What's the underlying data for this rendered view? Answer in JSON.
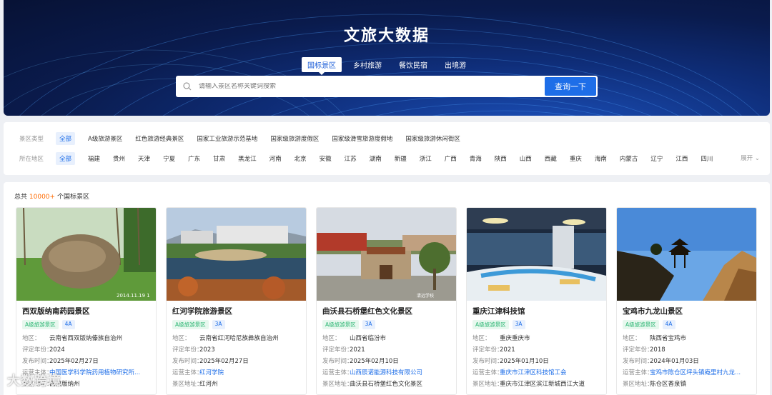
{
  "banner": {
    "title": "文旅大数据",
    "tabs": [
      {
        "label": "国标景区",
        "active": true
      },
      {
        "label": "乡村旅游"
      },
      {
        "label": "餐饮民宿"
      },
      {
        "label": "出境游"
      }
    ],
    "search_placeholder": "请输入景区名称关键词搜索",
    "search_button": "查询一下"
  },
  "filters": {
    "type_label": "景区类型",
    "type_options": [
      "全部",
      "A级旅游景区",
      "红色旅游经典景区",
      "国家工业旅游示范基地",
      "国家级旅游度假区",
      "国家级滑雪旅游度假地",
      "国家级旅游休闲街区"
    ],
    "region_label": "所在地区",
    "region_options": [
      "全部",
      "福建",
      "贵州",
      "天津",
      "宁夏",
      "广东",
      "甘肃",
      "黑龙江",
      "河南",
      "北京",
      "安徽",
      "江苏",
      "湖南",
      "新疆",
      "浙江",
      "广西",
      "青海",
      "陕西",
      "山西",
      "西藏",
      "重庆",
      "海南",
      "内蒙古",
      "辽宁",
      "江西",
      "四川"
    ],
    "expand": "展开"
  },
  "results": {
    "total_prefix": "总共",
    "total_count": "10000+",
    "total_suffix": "个国标景区"
  },
  "labels": {
    "region": "地区：",
    "year": "评定年份：",
    "published": "发布时间：",
    "operator": "运营主体：",
    "address": "景区地址："
  },
  "cards": [
    {
      "title": "西双版纳南药园景区",
      "badge": "A级旅游景区",
      "level": "4A",
      "region": "云南省西双版纳傣族自治州",
      "year": "2024",
      "published": "2025年02月27日",
      "operator": "中国医学科学院药用植物研究所...",
      "address": "西双版纳州"
    },
    {
      "title": "红河学院旅游景区",
      "badge": "A级旅游景区",
      "level": "3A",
      "region": "云南省红河哈尼族彝族自治州",
      "year": "2023",
      "published": "2025年02月27日",
      "operator": "红河学院",
      "address": "红河州"
    },
    {
      "title": "曲沃县石桥堡红色文化景区",
      "badge": "A级旅游景区",
      "level": "3A",
      "region": "山西省临汾市",
      "year": "2021",
      "published": "2025年02月10日",
      "operator": "山西辰诺能源科技有限公司",
      "address": "曲沃县石桥堡红色文化景区"
    },
    {
      "title": "重庆江津科技馆",
      "badge": "A级旅游景区",
      "level": "3A",
      "region": "重庆重庆市",
      "year": "2021",
      "published": "2025年01月10日",
      "operator": "重庆市江津区科技馆工会",
      "address": "重庆市江津区滨江新城西江大道"
    },
    {
      "title": "宝鸡市九龙山景区",
      "badge": "A级旅游景区",
      "level": "4A",
      "region": "陕西省宝鸡市",
      "year": "2018",
      "published": "2024年01月03日",
      "operator": "宝鸡市陈仓区坪头镇庵里村九龙...",
      "address": "陈仓区香泉镇"
    }
  ],
  "watermark": "大数跨境",
  "photo_stamps": [
    "2014.11.19  1",
    "清远学校"
  ]
}
